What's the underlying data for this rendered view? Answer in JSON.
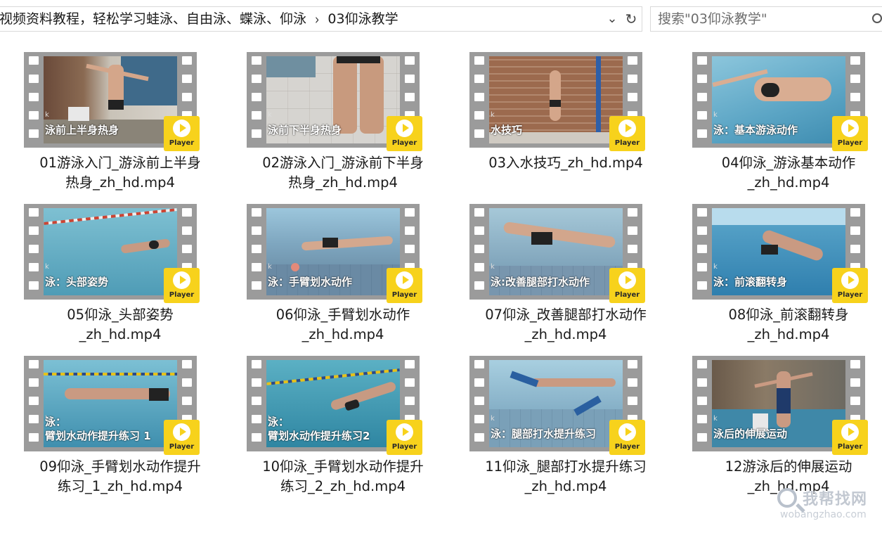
{
  "address_bar": {
    "path": [
      "视频资料教程，轻松学习蛙泳、自由泳、蝶泳、仰泳",
      "03仰泳教学"
    ],
    "separator": "›",
    "chevron": "⌄",
    "refresh": "↻"
  },
  "search": {
    "placeholder": "搜索\"03仰泳教学\""
  },
  "player_label": "Player",
  "files": [
    {
      "name_lines": [
        "01游泳入门_游泳前上半身",
        "热身_zh_hd.mp4"
      ],
      "caption": [
        "泳前上半身热身"
      ],
      "scene": "gym-arms"
    },
    {
      "name_lines": [
        "02游泳入门_游泳前下半身",
        "热身_zh_hd.mp4"
      ],
      "caption": [
        "泳前下半身热身"
      ],
      "scene": "legs"
    },
    {
      "name_lines": [
        "03入水技巧_zh_hd.mp4"
      ],
      "caption": [
        "水技巧"
      ],
      "scene": "brick-wall"
    },
    {
      "name_lines": [
        "04仰泳_游泳基本动作",
        "_zh_hd.mp4"
      ],
      "caption": [
        "泳：基本游泳动作"
      ],
      "scene": "pool-top"
    },
    {
      "name_lines": [
        "05仰泳_头部姿势",
        "_zh_hd.mp4"
      ],
      "caption": [
        "泳：头部姿势"
      ],
      "scene": "pool-lane"
    },
    {
      "name_lines": [
        "06仰泳_手臂划水动作",
        "_zh_hd.mp4"
      ],
      "caption": [
        "泳：手臂划水动作"
      ],
      "scene": "underwater"
    },
    {
      "name_lines": [
        "07仰泳_改善腿部打水动作",
        "_zh_hd.mp4"
      ],
      "caption": [
        "泳:改善腿部打水动作"
      ],
      "scene": "underwater2"
    },
    {
      "name_lines": [
        "08仰泳_前滚翻转身",
        "_zh_hd.mp4"
      ],
      "caption": [
        "泳：前滚翻转身"
      ],
      "scene": "underwater3"
    },
    {
      "name_lines": [
        "09仰泳_手臂划水动作提升",
        "练习_1_zh_hd.mp4"
      ],
      "caption": [
        "泳：",
        "臂划水动作提升练习 1"
      ],
      "scene": "underwater4"
    },
    {
      "name_lines": [
        "10仰泳_手臂划水动作提升",
        "练习_2_zh_hd.mp4"
      ],
      "caption": [
        "泳：",
        "臂划水动作提升练习2"
      ],
      "scene": "pool-lane2"
    },
    {
      "name_lines": [
        "11仰泳_腿部打水提升练习",
        "_zh_hd.mp4"
      ],
      "caption": [
        "泳：腿部打水提升练习"
      ],
      "scene": "fins"
    },
    {
      "name_lines": [
        "12游泳后的伸展运动",
        "_zh_hd.mp4"
      ],
      "caption": [
        "泳后的伸展运动"
      ],
      "scene": "stretch"
    }
  ],
  "watermark": {
    "title": "我帮找网",
    "url": "wobangzhao.com"
  }
}
